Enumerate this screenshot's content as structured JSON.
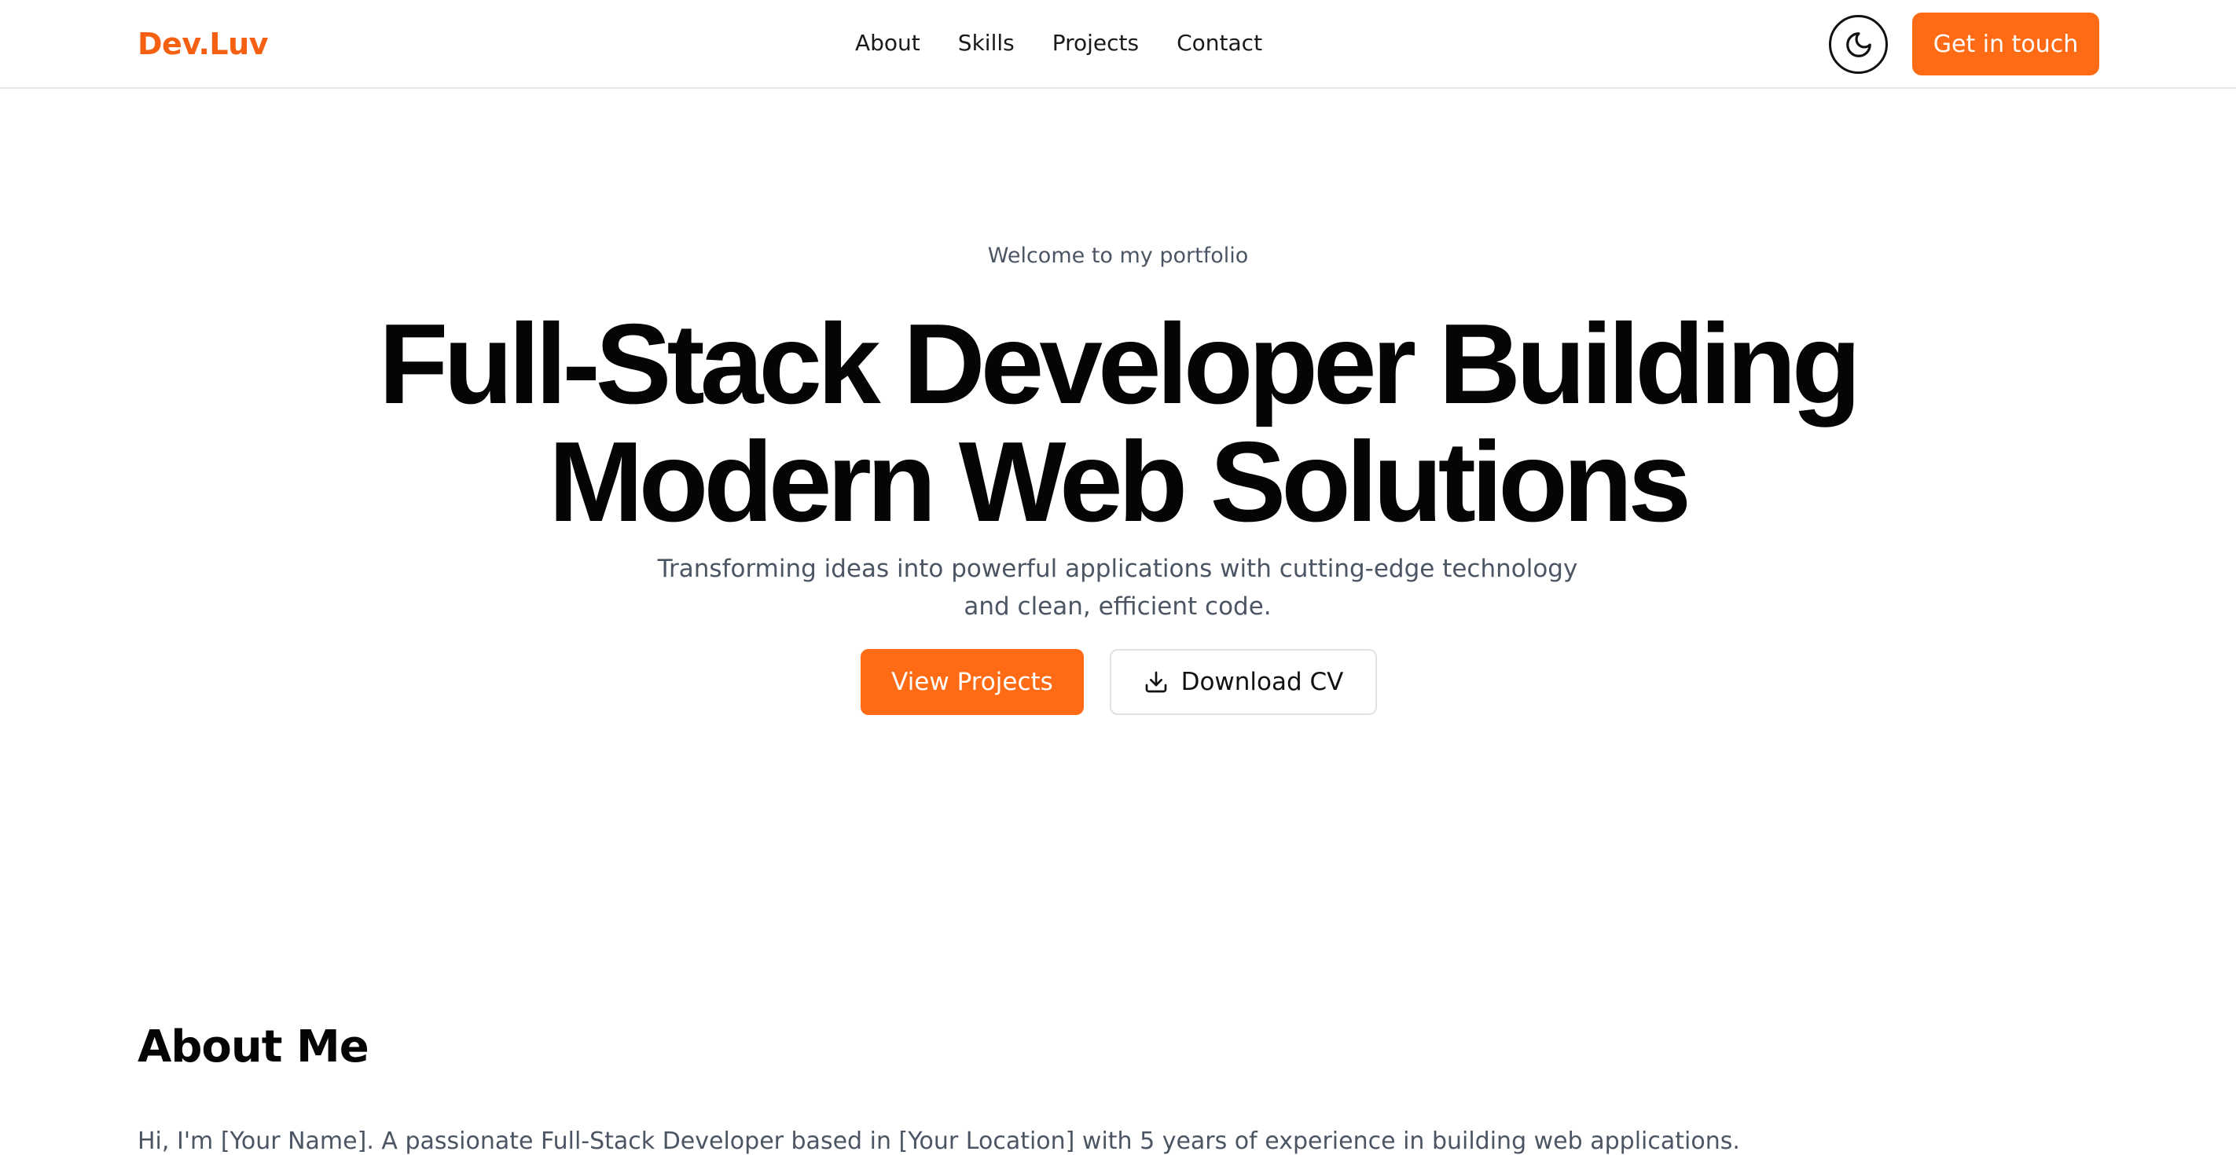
{
  "nav": {
    "brand": "Dev.Luv",
    "links": [
      {
        "label": "About"
      },
      {
        "label": "Skills"
      },
      {
        "label": "Projects"
      },
      {
        "label": "Contact"
      }
    ],
    "theme_toggle_icon": "moon-icon",
    "cta_label": "Get in touch"
  },
  "hero": {
    "eyebrow": "Welcome to my portfolio",
    "title_line1": "Full-Stack Developer Building",
    "title_line2": "Modern Web Solutions",
    "subtitle_line1": "Transforming ideas into powerful applications with cutting-edge technology",
    "subtitle_line2": "and clean, efficient code.",
    "primary_button": "View Projects",
    "secondary_button": "Download CV",
    "secondary_icon": "download-icon"
  },
  "about": {
    "title": "About Me",
    "text": "Hi, I'm [Your Name]. A passionate Full-Stack Developer based in [Your Location] with 5 years of experience in building web applications."
  },
  "colors": {
    "accent": "#ff6a14",
    "brand": "#f66012",
    "muted_text": "#4b5563"
  }
}
